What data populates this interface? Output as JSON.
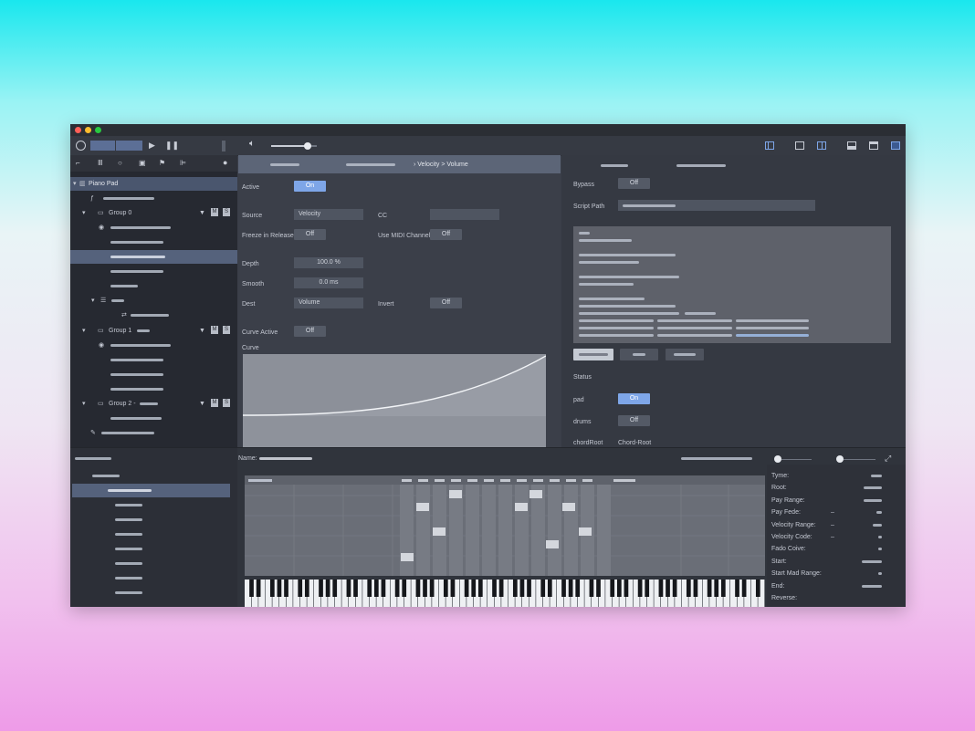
{
  "window": {
    "traffic_lights": [
      "#ff5f57",
      "#febc2e",
      "#28c840"
    ]
  },
  "toolbar": {
    "left_icon": "power-icon",
    "play_icon": "play-icon",
    "pause_icon": "pause-icon",
    "volume_icon": "speaker-icon",
    "volume_level": 0.8,
    "layout_icons": [
      "sidebar-left-icon",
      "single-pane-icon",
      "split-pane-icon",
      "bottom-panel-icon",
      "top-panel-icon",
      "grid-panel-icon"
    ]
  },
  "sidebar": {
    "tool_icons": [
      "folder-icon",
      "library-icon",
      "circle-icon",
      "square-icon",
      "flag-icon",
      "align-icon",
      "more-icon"
    ],
    "root_label": "Piano Pad",
    "groups": [
      {
        "label": "Group 0"
      },
      {
        "label": "Group 1"
      },
      {
        "label": "Group 2 -"
      }
    ],
    "m_label": "M",
    "s_label": "S"
  },
  "modulation": {
    "breadcrumb": "› Velocity > Volume",
    "active_label": "Active",
    "active_value": "On",
    "source_label": "Source",
    "source_value": "Velocity",
    "cc_label": "CC",
    "freeze_label": "Freeze in Release",
    "freeze_value": "Off",
    "midi_channel_label": "Use MIDI Channel",
    "midi_channel_value": "Off",
    "depth_label": "Depth",
    "depth_value": "100.0 %",
    "smooth_label": "Smooth",
    "smooth_value": "0.0 ms",
    "dest_label": "Dest",
    "dest_value": "Volume",
    "invert_label": "Invert",
    "invert_value": "Off",
    "curve_active_label": "Curve Active",
    "curve_active_value": "Off",
    "curve_label": "Curve"
  },
  "script": {
    "bypass_label": "Bypass",
    "bypass_value": "Off",
    "script_path_label": "Script Path",
    "status_label": "Status",
    "pad_label": "pad",
    "pad_value": "On",
    "drums_label": "drums",
    "drums_value": "Off",
    "chordroot_label": "chordRoot",
    "chordroot_value": "Chord-Root"
  },
  "editor": {
    "name_label": "Name:",
    "fullscreen_icon": "expand-icon"
  },
  "zone_props": {
    "labels": [
      "Tyme:",
      "Root:",
      "Pay Range:",
      "Pay Fede:",
      "Velocity Range:",
      "Velocity Code:",
      "Fado Coive:",
      "Start:",
      "Start Mad Range:",
      "End:",
      "Reverse:"
    ],
    "values": [
      "",
      "",
      "",
      "–",
      "–",
      "–",
      "",
      "",
      "",
      "",
      ""
    ]
  },
  "colors": {
    "accent": "#7ea6e8",
    "selection": "#55627c"
  }
}
